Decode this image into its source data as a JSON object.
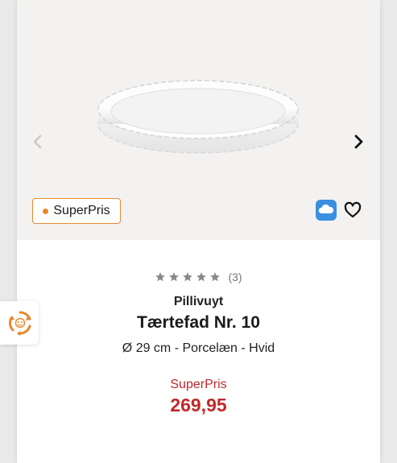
{
  "product": {
    "badge_label": "SuperPris",
    "rating_count": "(3)",
    "brand": "Pillivuyt",
    "name": "Tærtefad Nr. 10",
    "description": "Ø 29 cm - Porcelæn - Hvid",
    "price_label": "SuperPris",
    "price": "269,95",
    "rating_stars": 5
  },
  "colors": {
    "accent_orange": "#e8892f",
    "price_red": "#c0292b",
    "cloud_blue": "#3b8fe0"
  },
  "icons": {
    "prev": "chevron-left-icon",
    "next": "chevron-right-icon",
    "cloud": "cloud-icon",
    "wishlist": "heart-icon",
    "side_widget": "recycle-icon"
  }
}
